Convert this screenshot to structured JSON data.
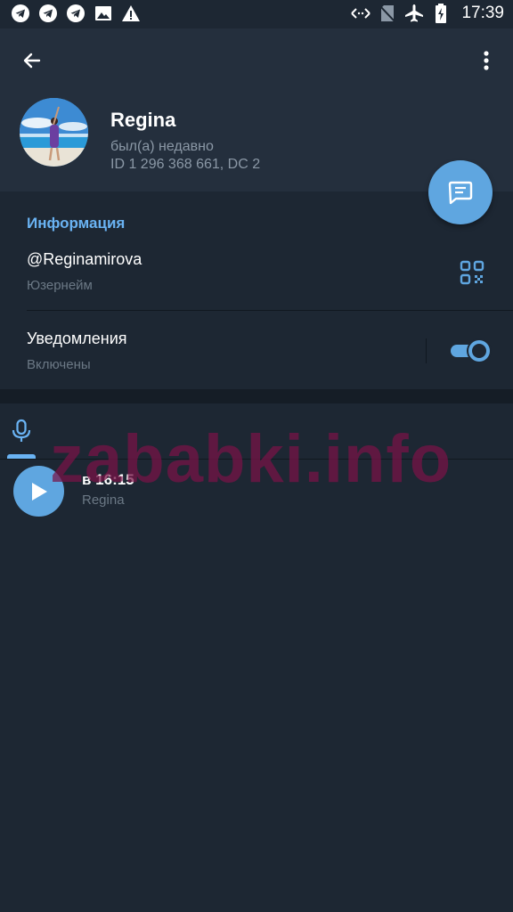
{
  "status_bar": {
    "time": "17:39",
    "left_icons": [
      "telegram-icon",
      "telegram-icon",
      "telegram-icon",
      "image-icon",
      "warning-icon"
    ],
    "right_icons": [
      "data-arrows-icon",
      "no-sim-icon",
      "airplane-icon",
      "battery-charging-icon"
    ]
  },
  "profile": {
    "name": "Regina",
    "status": "был(а) недавно",
    "id_line": "ID 1 296 368 661, DC 2"
  },
  "info": {
    "section_title": "Информация",
    "username": "@Reginamirova",
    "username_label": "Юзернейм",
    "notifications_label": "Уведомления",
    "notifications_state": "Включены",
    "notifications_on": true
  },
  "media_tabs": {
    "active": "voice"
  },
  "voice_messages": [
    {
      "title": "в 16:15",
      "author": "Regina"
    }
  ],
  "watermark": "zababki.info",
  "colors": {
    "accent": "#5fa6e0",
    "link_blue": "#6ab3f3",
    "background": "#1d2733",
    "header_bg": "#242f3d"
  }
}
